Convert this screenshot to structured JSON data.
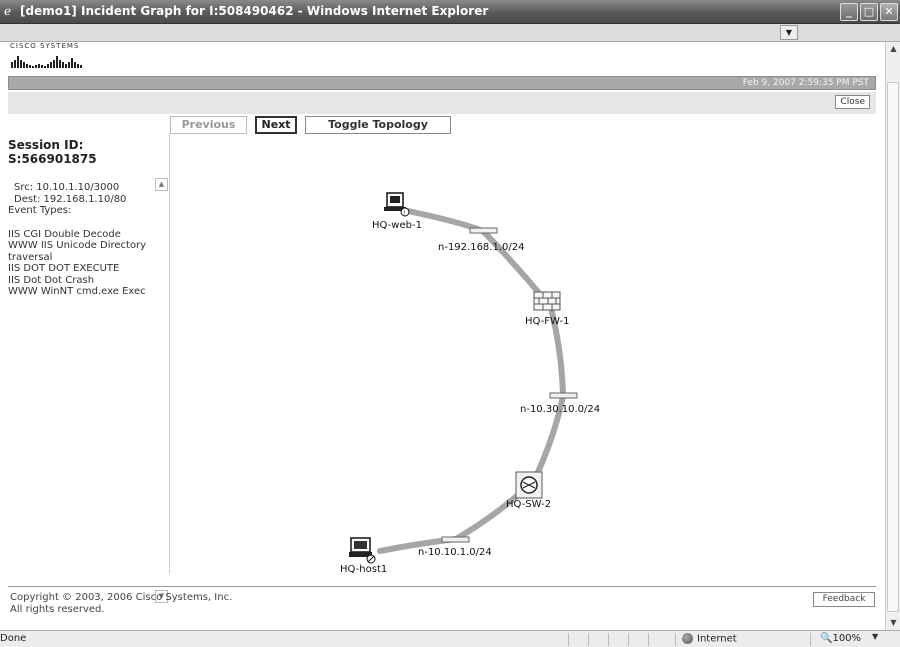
{
  "window": {
    "title": "[demo1] Incident Graph for I:508490462 - Windows Internet Explorer",
    "controls": [
      "_",
      "□",
      "✕"
    ]
  },
  "header": {
    "logo_text": "CISCO SYSTEMS",
    "timestamp": "Feb 9, 2007 2:59:35 PM PST",
    "close_label": "Close"
  },
  "toolbar": {
    "previous_label": "Previous",
    "next_label": "Next",
    "toggle_label": "Toggle Topology"
  },
  "session": {
    "id_label": "Session ID:",
    "id_value": "S:566901875",
    "src": "Src: 10.10.1.10/3000",
    "dest": "Dest: 192.168.1.10/80",
    "event_types_label": "Event Types:",
    "events": [
      "IIS CGI Double Decode",
      "WWW IIS Unicode Directory traversal",
      "IIS DOT DOT EXECUTE",
      "IIS Dot Dot Crash",
      "WWW WinNT cmd.exe Exec"
    ]
  },
  "graph": {
    "nodes": [
      {
        "id": "web",
        "label": "HQ-web-1",
        "type": "server"
      },
      {
        "id": "fw",
        "label": "HQ-FW-1",
        "type": "firewall"
      },
      {
        "id": "sw",
        "label": "HQ-SW-2",
        "type": "switch"
      },
      {
        "id": "host",
        "label": "HQ-host1",
        "type": "host"
      }
    ],
    "networks": [
      {
        "id": "n1",
        "label": "n-192.168.1.0/24"
      },
      {
        "id": "n2",
        "label": "n-10.30.10.0/24"
      },
      {
        "id": "n3",
        "label": "n-10.10.1.0/24"
      }
    ],
    "colors": {
      "link": "#a6a6a6",
      "bar": "#f0f0f0"
    }
  },
  "footer": {
    "copyright_line1": "Copyright © 2003, 2006 Cisco Systems, Inc.",
    "copyright_line2": "All rights reserved.",
    "feedback_label": "Feedback"
  },
  "status": {
    "text": "Done",
    "zone": "Internet",
    "zoom": "100%"
  }
}
